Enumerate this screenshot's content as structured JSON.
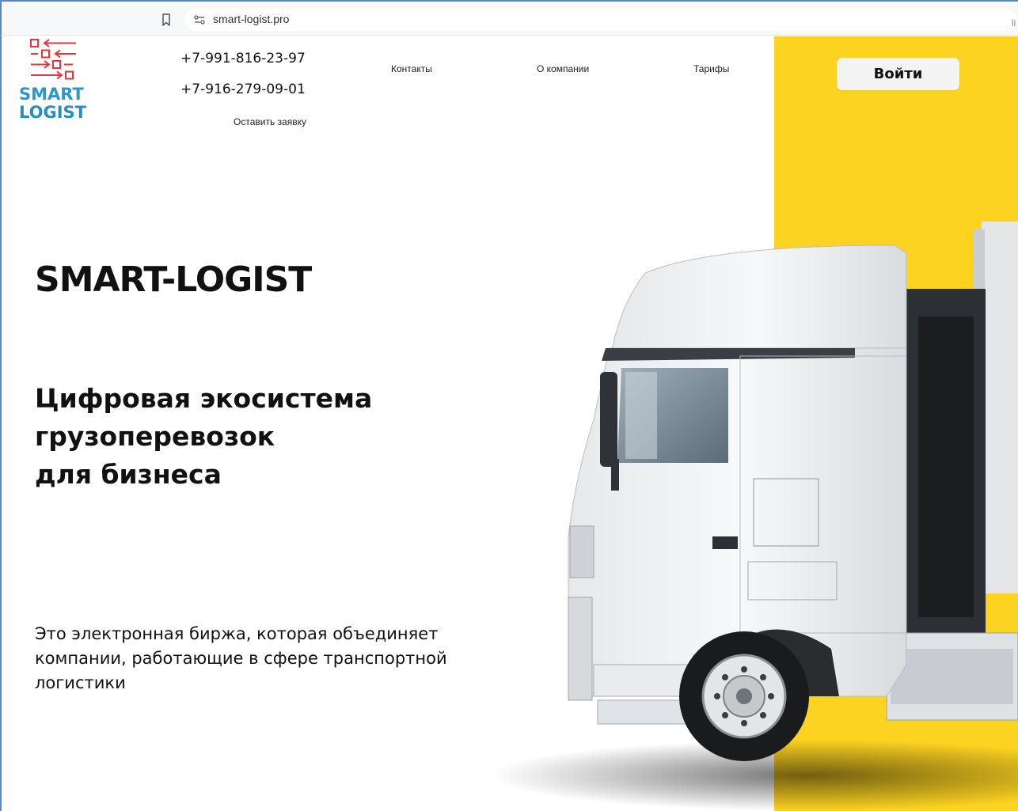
{
  "browser": {
    "url": "smart-logist.pro",
    "right_mark": "li"
  },
  "logo": {
    "line1": "SMART",
    "line2": "LOGIST",
    "colors": {
      "red": "#e8343a",
      "blue": "#2c97c8"
    }
  },
  "header": {
    "phones": [
      "+7-991-816-23-97",
      "+7-916-279-09-01"
    ],
    "request_link": "Оставить заявку",
    "nav": {
      "contacts": "Контакты",
      "about": "О компании",
      "tariffs": "Тарифы"
    },
    "login_label": "Войти"
  },
  "hero": {
    "title": "SMART-LOGIST",
    "subtitle_lines": [
      "Цифровая экосистема",
      "грузоперевозок",
      "для бизнеса"
    ],
    "description": "Это электронная биржа, которая объединяет компании, работающие в сфере транспортной логистики"
  },
  "colors": {
    "accent_yellow": "#fdd321",
    "window_border": "#5d86b8"
  },
  "images": {
    "hero_image": "white-truck-illustration"
  }
}
